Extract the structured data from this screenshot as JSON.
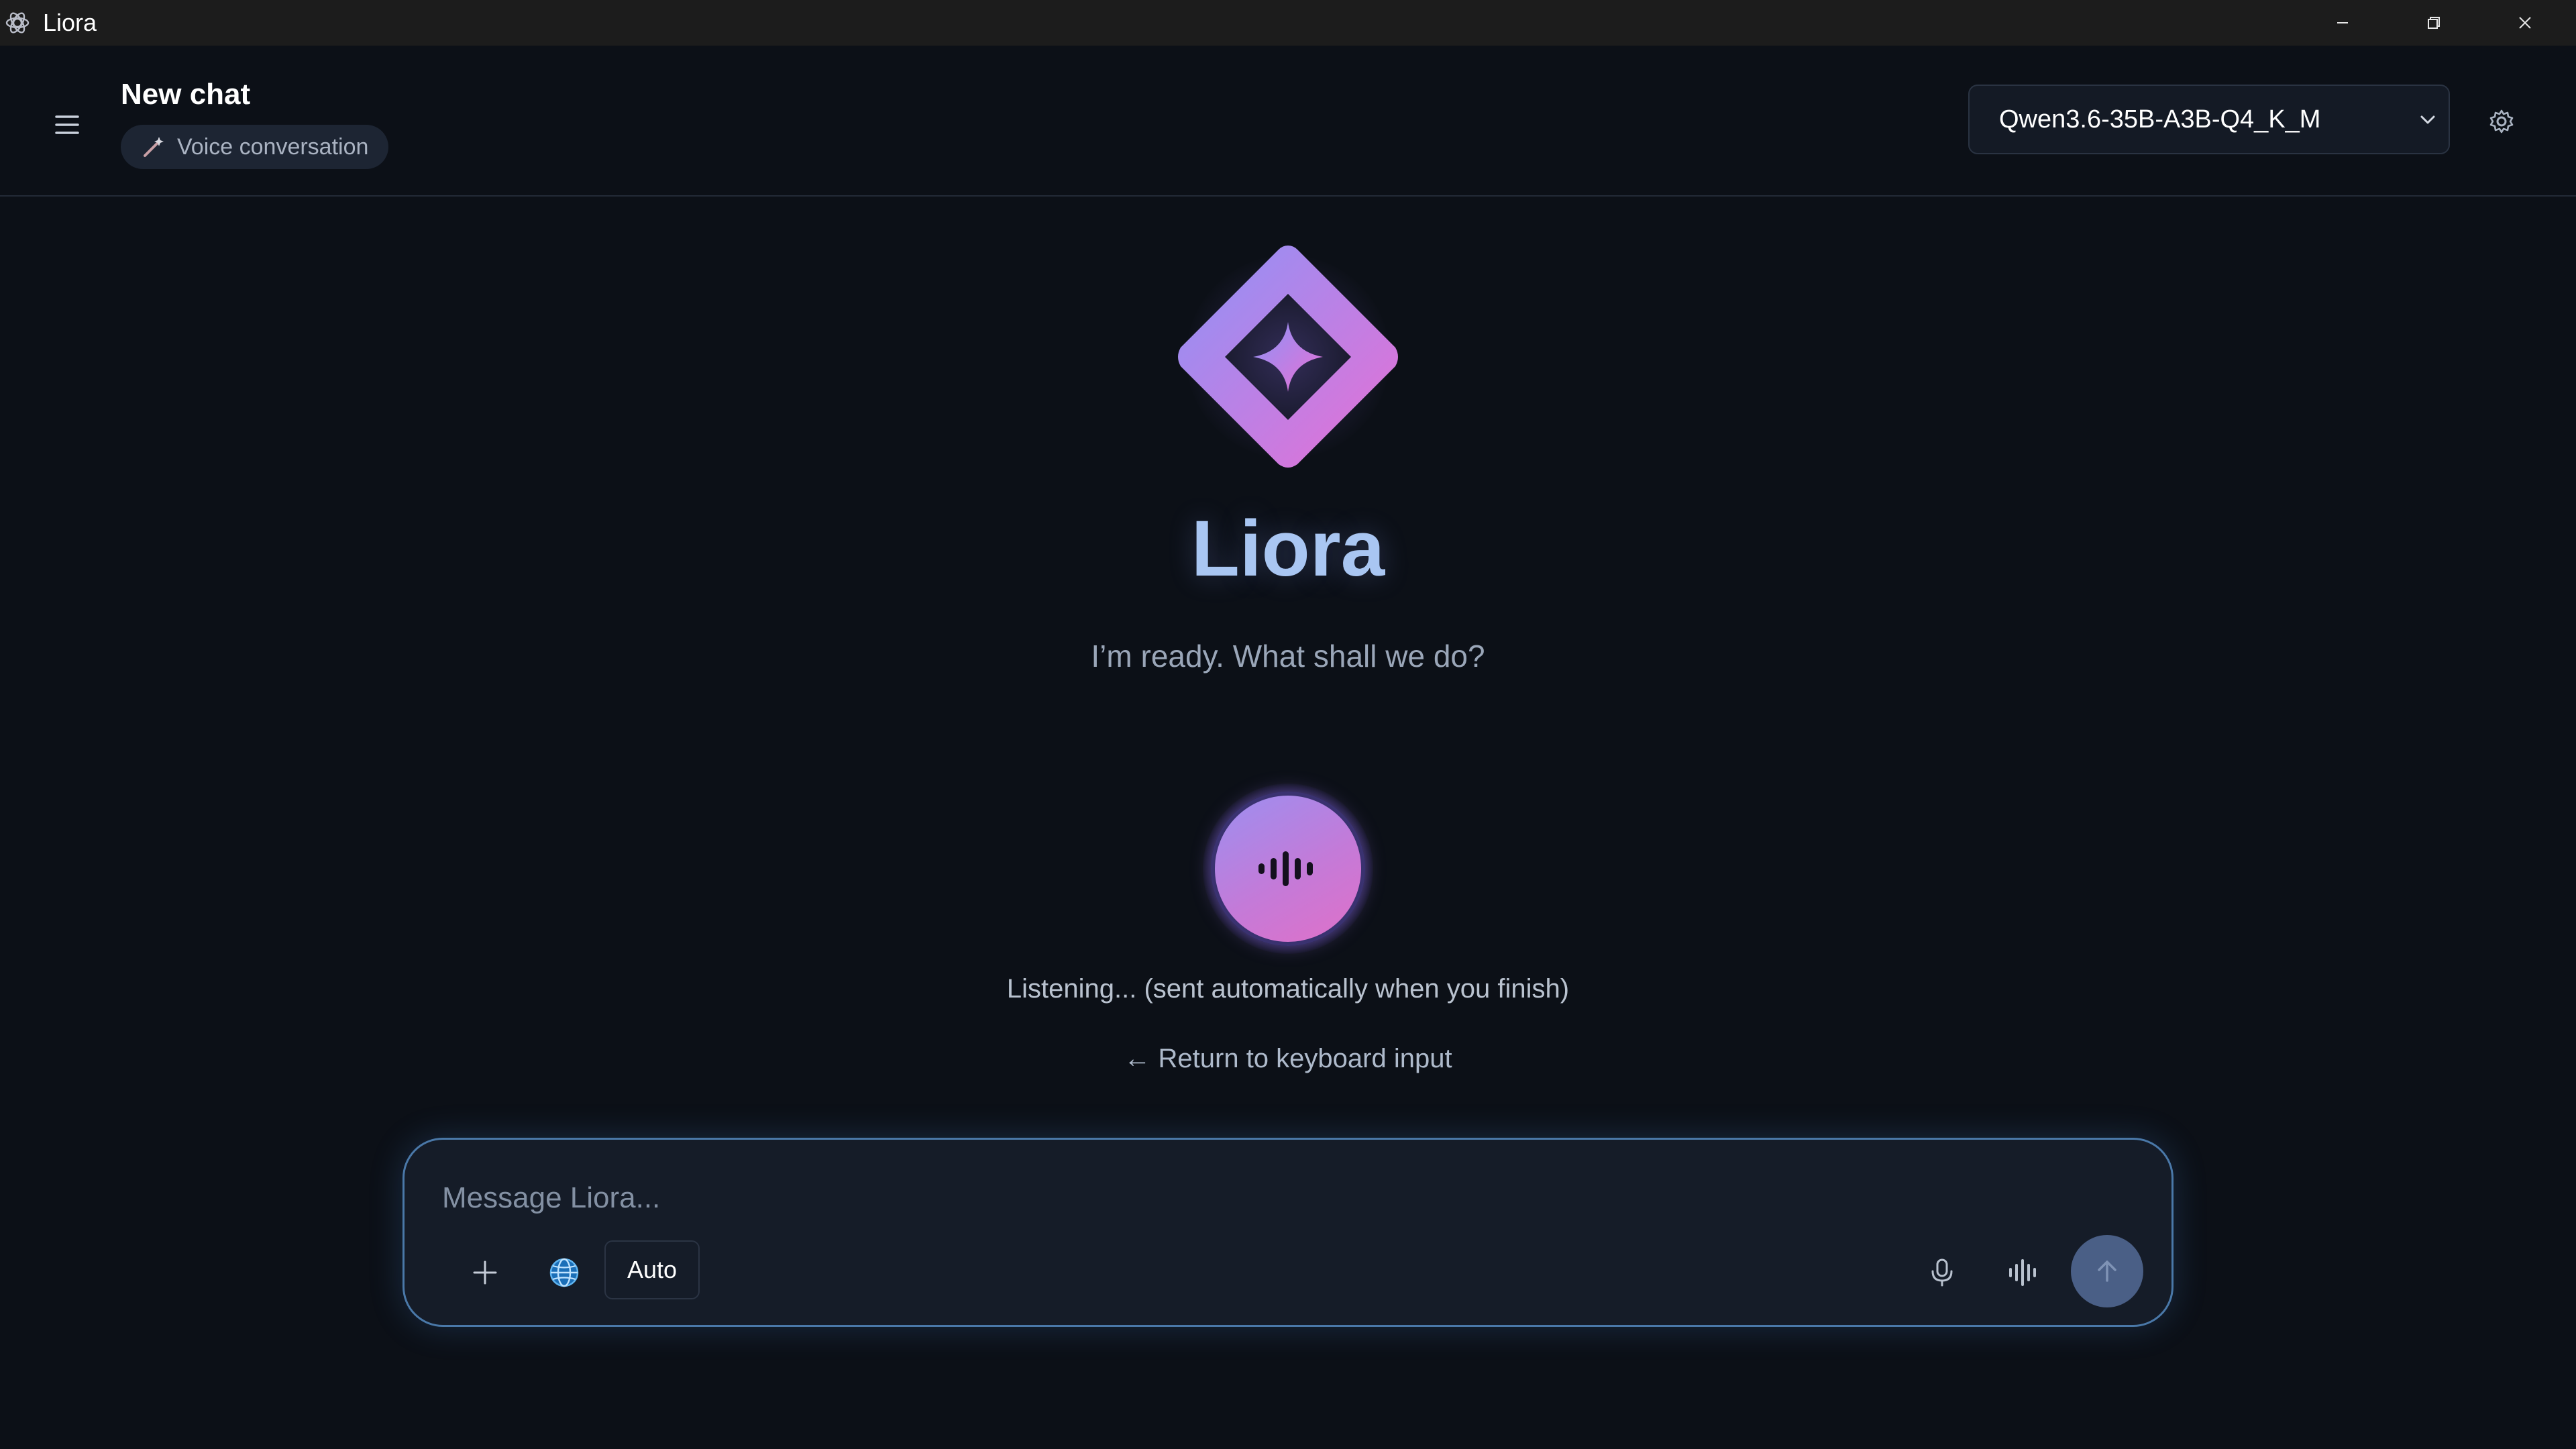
{
  "window": {
    "title": "Liora"
  },
  "header": {
    "menu_icon": "hamburger-menu-icon",
    "title": "New chat",
    "mode_chip": {
      "icon": "wand-icon",
      "label": "Voice conversation"
    },
    "model_select": {
      "value": "Qwen3.6-35B-A3B-Q4_K_M"
    },
    "settings_icon": "gear-icon"
  },
  "hero": {
    "logo": "diamond-sparkle-logo",
    "brand": "Liora",
    "tagline": "I’m ready. What shall we do?"
  },
  "voice": {
    "orb_icon": "audio-waveform-icon",
    "status": "Listening... (sent automatically when you finish)",
    "return_link": "← Return to keyboard input"
  },
  "composer": {
    "placeholder": "Message Liora...",
    "value": "",
    "auto_label": "Auto",
    "icons": {
      "add": "plus-icon",
      "web": "globe-icon",
      "mic": "microphone-icon",
      "voice": "waveform-icon",
      "send": "arrow-up-icon"
    }
  },
  "colors": {
    "background": "#0c1017",
    "accent_border": "#4a78a8",
    "brand_text": "#a9c6f2",
    "gradient_start": "#8f8cf5",
    "gradient_end": "#e070d8"
  }
}
